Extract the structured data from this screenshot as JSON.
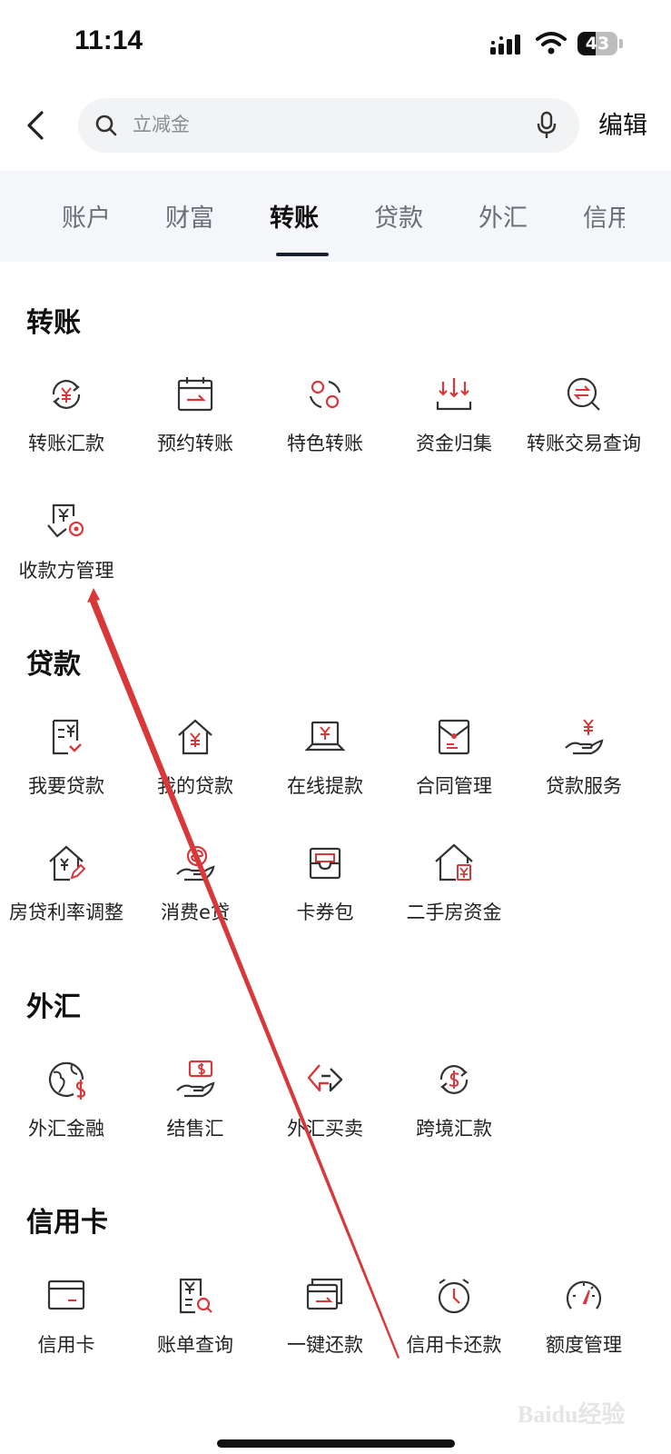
{
  "status_bar": {
    "time": "11:14",
    "battery": "43"
  },
  "search": {
    "placeholder": "立减金"
  },
  "header": {
    "edit_label": "编辑"
  },
  "tabs": [
    {
      "label": "账户"
    },
    {
      "label": "财富"
    },
    {
      "label": "转账"
    },
    {
      "label": "贷款"
    },
    {
      "label": "外汇"
    },
    {
      "label": "信用"
    }
  ],
  "sections": {
    "transfer": {
      "title": "转账",
      "items": [
        {
          "label": "转账汇款",
          "icon": "yuan-cycle-icon"
        },
        {
          "label": "预约转账",
          "icon": "calendar-transfer-icon"
        },
        {
          "label": "特色转账",
          "icon": "circles-icon"
        },
        {
          "label": "资金归集",
          "icon": "collect-icon"
        },
        {
          "label": "转账交易查询",
          "icon": "transfer-search-icon"
        },
        {
          "label": "收款方管理",
          "icon": "payee-settings-icon"
        }
      ]
    },
    "loan": {
      "title": "贷款",
      "items": [
        {
          "label": "我要贷款",
          "icon": "loan-document-icon"
        },
        {
          "label": "我的贷款",
          "icon": "house-yuan-icon"
        },
        {
          "label": "在线提款",
          "icon": "laptop-yuan-icon"
        },
        {
          "label": "合同管理",
          "icon": "envelope-icon"
        },
        {
          "label": "贷款服务",
          "icon": "hand-yuan-icon"
        },
        {
          "label": "房贷利率调整",
          "icon": "house-edit-icon"
        },
        {
          "label": "消费e贷",
          "icon": "hand-e-icon"
        },
        {
          "label": "卡券包",
          "icon": "coupon-wallet-icon"
        },
        {
          "label": "二手房资金",
          "icon": "home-fund-icon"
        }
      ]
    },
    "forex": {
      "title": "外汇",
      "items": [
        {
          "label": "外汇金融",
          "icon": "globe-dollar-icon"
        },
        {
          "label": "结售汇",
          "icon": "hand-dollar-icon"
        },
        {
          "label": "外汇买卖",
          "icon": "exchange-arrows-icon"
        },
        {
          "label": "跨境汇款",
          "icon": "dollar-cycle-icon"
        }
      ]
    },
    "credit_card": {
      "title": "信用卡",
      "items": [
        {
          "label": "信用卡",
          "icon": "credit-card-icon"
        },
        {
          "label": "账单查询",
          "icon": "bill-search-icon"
        },
        {
          "label": "一键还款",
          "icon": "card-repay-icon"
        },
        {
          "label": "信用卡还款",
          "icon": "alarm-clock-icon"
        },
        {
          "label": "额度管理",
          "icon": "gauge-icon"
        }
      ]
    }
  },
  "watermark": {
    "text": "Baidu经验"
  },
  "colors": {
    "accent": "#d9383a",
    "icon_dark": "#333333",
    "tab_bg": "#f5f6f9"
  }
}
